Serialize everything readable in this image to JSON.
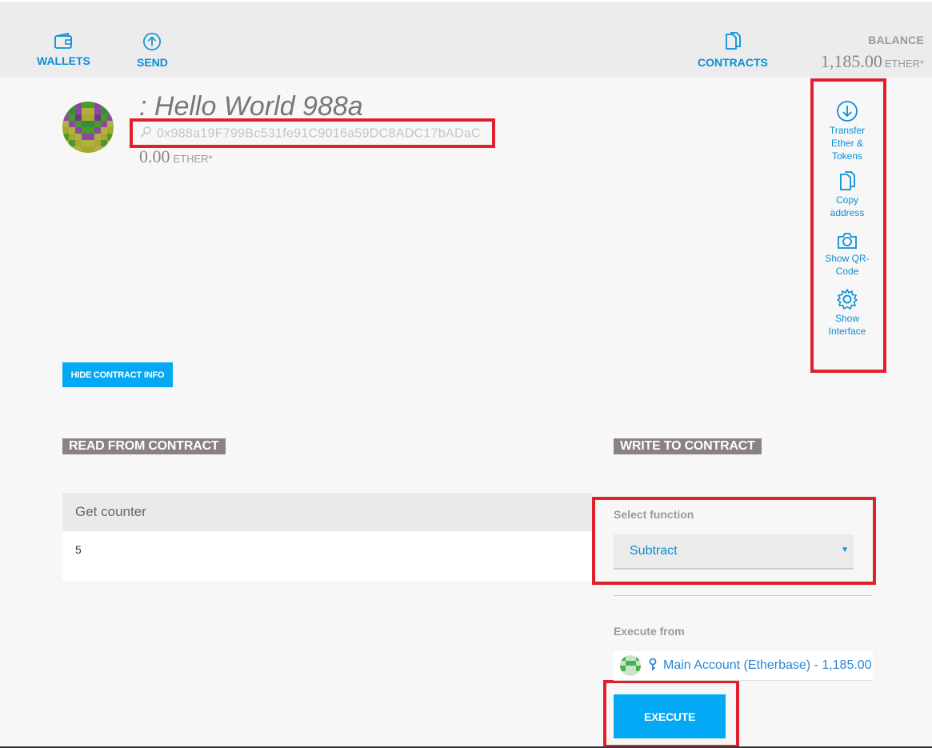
{
  "nav": {
    "wallets": "WALLETS",
    "send": "SEND",
    "contracts": "CONTRACTS"
  },
  "balance": {
    "label": "BALANCE",
    "amount": "1,185.00",
    "unit": "ETHER*"
  },
  "contract": {
    "name": ": Hello World 988a",
    "address": "0x988a19F799Bc531fe91C9016a59DC8ADC17bADaC",
    "amount": "0.00",
    "unit": "ETHER*"
  },
  "actions": {
    "transfer": "Transfer Ether & Tokens",
    "copy": "Copy address",
    "qr": "Show QR-Code",
    "interface": "Show Interface"
  },
  "hide_info_button": "HIDE CONTRACT INFO",
  "read": {
    "heading": "READ FROM CONTRACT",
    "function_name": "Get counter",
    "value": "5"
  },
  "write": {
    "heading": "WRITE TO CONTRACT",
    "select_label": "Select function",
    "selected_function": "Subtract",
    "execute_from_label": "Execute from",
    "account": "Main Account (Etherbase) - 1,185.00",
    "execute_button": "EXECUTE"
  },
  "colors": {
    "accent": "#0a8fd4",
    "button": "#03a9f4",
    "highlight": "#e0202a"
  }
}
